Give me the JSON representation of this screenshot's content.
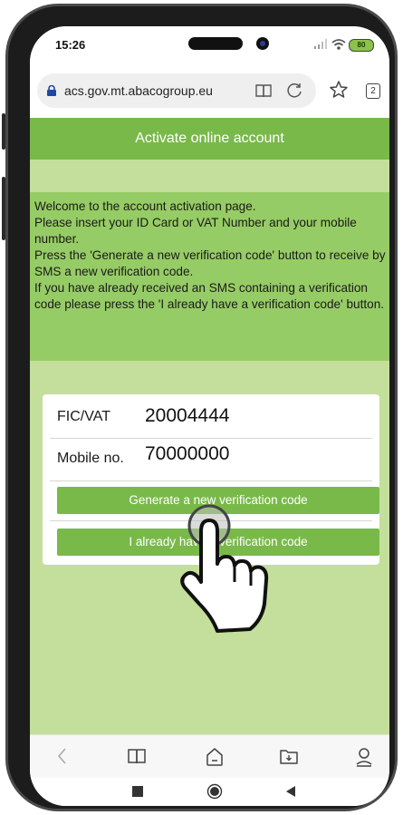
{
  "status_bar": {
    "time": "15:26",
    "battery": "80"
  },
  "browser": {
    "url": "acs.gov.mt.abacogroup.eu",
    "tab_count": "2"
  },
  "page": {
    "title": "Activate online account",
    "info_lines": [
      "Welcome to the account activation page.",
      "Please insert your ID Card or VAT Number and your mobile number.",
      "Press the 'Generate a new verification code' button to receive by SMS a new verification code.",
      "If you have already received an SMS containing a verification code please press the 'I already have a verification code' button."
    ],
    "form": {
      "fic_label": "FIC/VAT",
      "fic_value": "20004444",
      "mobile_label": "Mobile no.",
      "mobile_value": "70000000",
      "generate_button": "Generate a new verification code",
      "already_button": "I already have a verification code"
    }
  },
  "colors": {
    "header_green": "#79b94a",
    "page_bg": "#c3df9b",
    "info_bg": "#96cc65"
  },
  "icons": {
    "lock": "lock-icon",
    "reader": "book-icon",
    "refresh": "refresh-icon",
    "star": "star-icon",
    "back": "chevron-left-icon",
    "bookmarks": "book-icon",
    "home": "home-icon",
    "downloads": "folder-download-icon",
    "profile": "profile-icon",
    "cursor": "hand-pointer-icon"
  }
}
